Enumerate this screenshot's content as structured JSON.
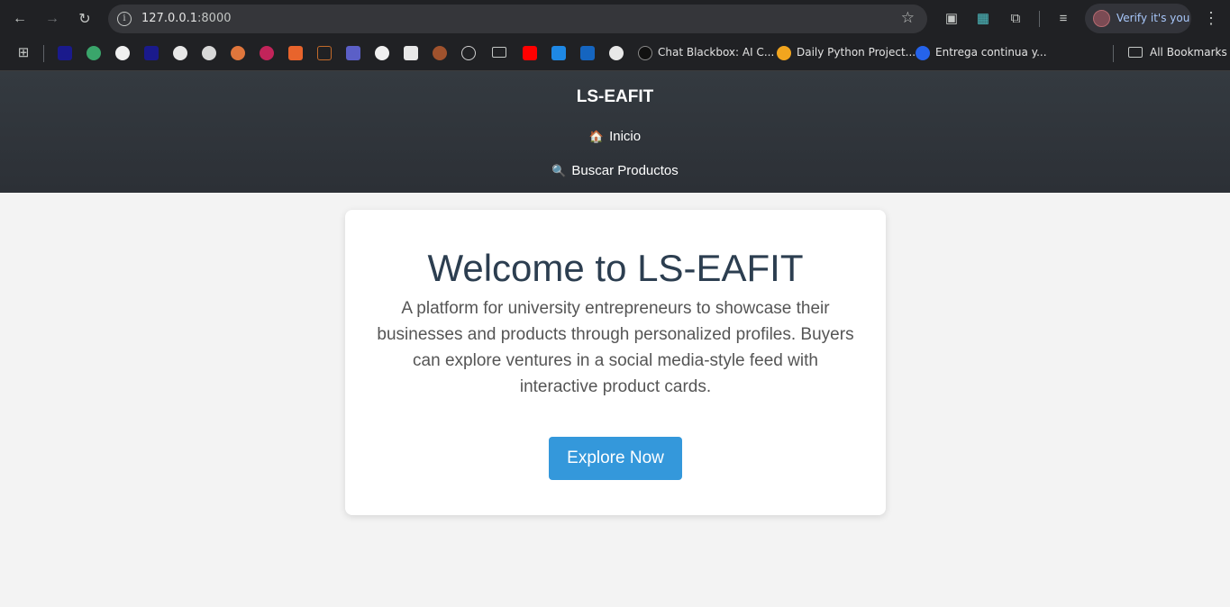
{
  "browser": {
    "url_host": "127.0.0.1",
    "url_port": ":8000",
    "profile_label": "Verify it's you",
    "bookmarks": [
      {
        "label": "Chat Blackbox: AI C..."
      },
      {
        "label": "Daily Python Project..."
      },
      {
        "label": "Entrega continua y..."
      }
    ],
    "all_bookmarks_label": "All Bookmarks"
  },
  "site": {
    "title": "LS-EAFIT",
    "nav": [
      {
        "icon": "🏠",
        "label": "Inicio"
      },
      {
        "icon": "🔍",
        "label": "Buscar Productos"
      }
    ]
  },
  "hero": {
    "heading": "Welcome to LS-EAFIT",
    "description": "A platform for university entrepreneurs to showcase their businesses and products through personalized profiles. Buyers can explore ventures in a social media-style feed with interactive product cards.",
    "cta_label": "Explore Now"
  },
  "colors": {
    "header_bg": "#343a40",
    "cta_bg": "#3498db",
    "heading": "#2c3e50"
  }
}
